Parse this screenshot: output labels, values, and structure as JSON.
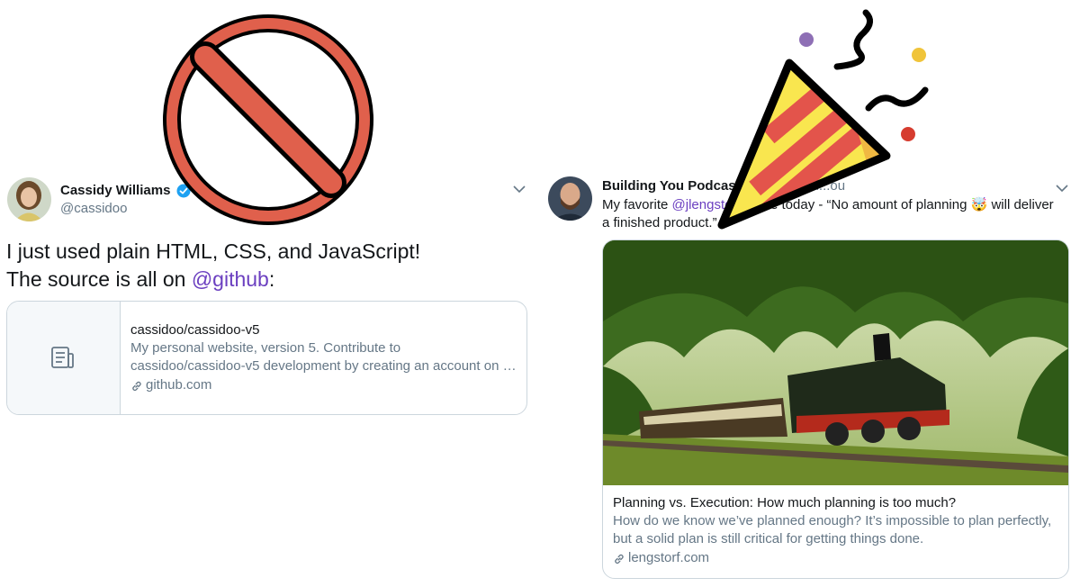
{
  "left_tweet": {
    "display_name": "Cassidy Williams",
    "handle": "@cassidoo",
    "text_line1": "I just used plain HTML, CSS, and JavaScript!",
    "text_line2_prefix": "The source is all on ",
    "text_line2_mention": "@github",
    "text_line2_suffix": ":",
    "card": {
      "title": "cassidoo/cassidoo-v5",
      "description_line1": "My personal website, version 5. Contribute to",
      "description_line2": "cassidoo/cassidoo-v5 development by creating an account on GitHub.",
      "domain": "github.com"
    }
  },
  "right_tweet": {
    "display_name": "Building You Podcast",
    "handle": "@bu...ou",
    "text_prefix": "My favorite ",
    "mention": "@jlengstorf",
    "text_suffix": " quote today - “No amount of planning 🤯 will deliver a finished product.”",
    "card": {
      "title": "Planning vs. Execution: How much planning is too much?",
      "description": "How do we know we’ve planned enough? It’s impossible to plan perfectly, but a solid plan is still critical for getting things done.",
      "domain": "lengstorf.com"
    }
  },
  "colors": {
    "mention": "#6b3fc0",
    "secondary_text": "#657786",
    "card_border": "#ccd6dd",
    "verified": "#1da1f2",
    "no_sign_red": "#e0604c",
    "confetti_purple": "#8e6fb5",
    "confetti_yellow": "#f0c43a",
    "confetti_red": "#d63c2f"
  },
  "icons": {
    "verified": "verified-badge-icon",
    "caret": "chevron-down-icon",
    "link": "link-icon",
    "document": "document-icon",
    "no_sign": "prohibited-icon",
    "party": "party-popper-icon"
  }
}
